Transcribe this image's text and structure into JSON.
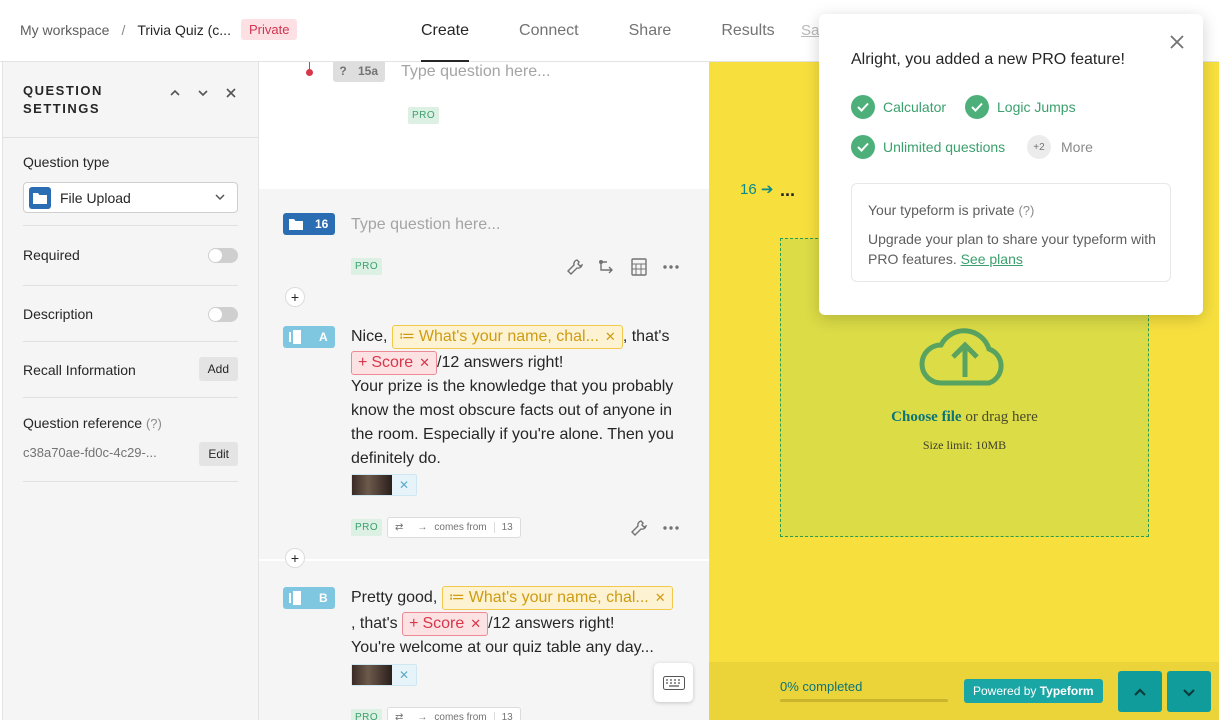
{
  "breadcrumb": {
    "workspace": "My workspace",
    "separator": "/",
    "form_title": "Trivia Quiz (c...",
    "visibility": "Private"
  },
  "tabs": [
    {
      "label": "Create"
    },
    {
      "label": "Connect"
    },
    {
      "label": "Share"
    },
    {
      "label": "Results"
    }
  ],
  "save_label": "Sa",
  "settings": {
    "title_line1": "QUESTION",
    "title_line2": "SETTINGS",
    "question_type_label": "Question type",
    "question_type_value": "File Upload",
    "required_label": "Required",
    "required_on": false,
    "description_label": "Description",
    "description_on": false,
    "recall_label": "Recall Information",
    "recall_button": "Add",
    "reference_label": "Question reference",
    "reference_hint": "(?)",
    "reference_value": "c38a70ae-fd0c-4c29-...",
    "reference_button": "Edit"
  },
  "builder": {
    "q15a": {
      "badge": "15a",
      "placeholder": "Type question here...",
      "pro": "PRO"
    },
    "q16": {
      "badge": "16",
      "placeholder": "Type question here...",
      "pro": "PRO"
    },
    "endA": {
      "badge": "A",
      "pre": "Nice,",
      "name_chip": "What's your name, chal...",
      "mid": ", that's",
      "score_chip": "Score",
      "post": "/12 answers right!",
      "body": "Your prize is the knowledge that you probably know the most obscure facts out of anyone in the room. Especially if you're alone. Then you definitely do.",
      "pro": "PRO",
      "comes_from": "comes from",
      "count": "13"
    },
    "endB": {
      "badge": "B",
      "pre": "Pretty good,",
      "name_chip": "What's your name, chal...",
      "mid": ", that's",
      "score_chip": "Score",
      "post": "/12 answers right!",
      "body": "You're welcome at our quiz table any day...",
      "pro": "PRO",
      "comes_from": "comes from",
      "count": "13"
    }
  },
  "preview": {
    "number": "16",
    "dots": "...",
    "choose": "Choose file",
    "drag": "or drag here",
    "limit": "Size limit: 10MB",
    "progress_text": "0% completed",
    "progress": 0,
    "powered_by": "Powered by",
    "brand": "Typeform"
  },
  "popover": {
    "title": "Alright, you added a new PRO feature!",
    "features": [
      "Calculator",
      "Logic Jumps",
      "Unlimited questions"
    ],
    "more_count": "+2",
    "more_label": "More",
    "private_title": "Your typeform is private",
    "private_hint": "(?)",
    "private_body": "Upgrade your plan to share your typeform with PRO features.",
    "see_plans": "See plans"
  },
  "colors": {
    "accent": "#0f9c9b",
    "preview_bg": "#f7e03e",
    "pro_green": "#3ba06d",
    "private_red": "#d0344f"
  }
}
